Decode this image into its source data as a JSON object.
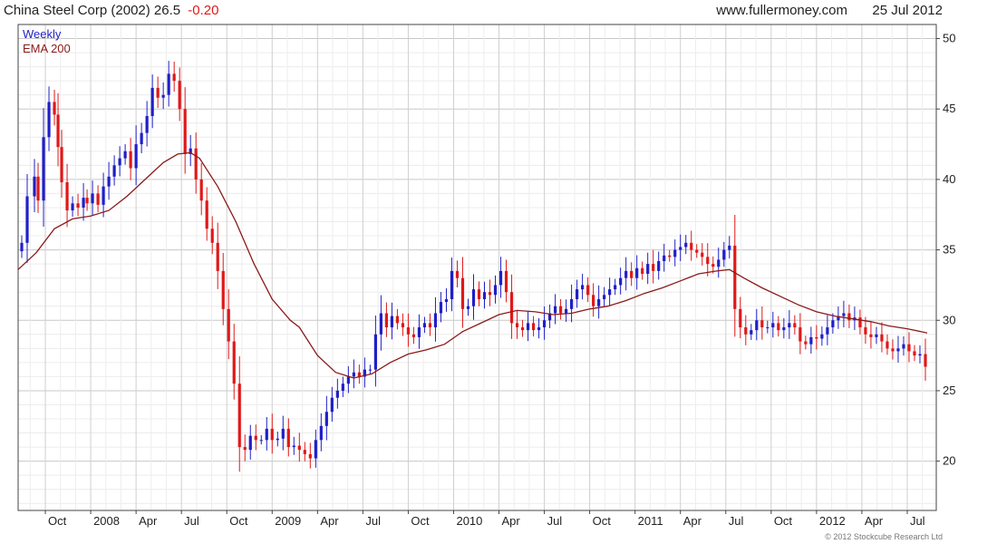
{
  "header": {
    "name_and_price": "China Steel Corp (2002) 26.5",
    "change": "-0.20",
    "site": "www.fullermoney.com",
    "date": "25 Jul 2012",
    "copyright": "© 2012 Stockcube Research Ltd"
  },
  "colors": {
    "up": "#1f1fc8",
    "down": "#e01818",
    "ema": "#8b1a1a",
    "grid": "#d8d8d8",
    "change": "#e01818"
  },
  "chart_data": {
    "type": "candlestick",
    "legend": [
      "Weekly",
      "EMA 200"
    ],
    "legend_placement": "top-left",
    "yaxis_side": "right",
    "ylim": [
      16.5,
      51
    ],
    "y_ticks": [
      20,
      25,
      30,
      35,
      40,
      45,
      50
    ],
    "x_range": [
      2007.6,
      2012.66
    ],
    "x_ticks": [
      {
        "label": "Oct",
        "x": 2007.75
      },
      {
        "label": "2008",
        "x": 2008.0
      },
      {
        "label": "Apr",
        "x": 2008.25
      },
      {
        "label": "Jul",
        "x": 2008.5
      },
      {
        "label": "Oct",
        "x": 2008.75
      },
      {
        "label": "2009",
        "x": 2009.0
      },
      {
        "label": "Apr",
        "x": 2009.25
      },
      {
        "label": "Jul",
        "x": 2009.5
      },
      {
        "label": "Oct",
        "x": 2009.75
      },
      {
        "label": "2010",
        "x": 2010.0
      },
      {
        "label": "Apr",
        "x": 2010.25
      },
      {
        "label": "Jul",
        "x": 2010.5
      },
      {
        "label": "Oct",
        "x": 2010.75
      },
      {
        "label": "2011",
        "x": 2011.0
      },
      {
        "label": "Apr",
        "x": 2011.25
      },
      {
        "label": "Jul",
        "x": 2011.5
      },
      {
        "label": "Oct",
        "x": 2011.75
      },
      {
        "label": "2012",
        "x": 2012.0
      },
      {
        "label": "Apr",
        "x": 2012.25
      },
      {
        "label": "Jul",
        "x": 2012.5
      }
    ],
    "weekly_close": [
      [
        2007.62,
        35.5
      ],
      [
        2007.65,
        38.8
      ],
      [
        2007.69,
        40.2
      ],
      [
        2007.71,
        38.5
      ],
      [
        2007.74,
        43.0
      ],
      [
        2007.77,
        45.5
      ],
      [
        2007.8,
        44.6
      ],
      [
        2007.82,
        42.3
      ],
      [
        2007.84,
        39.8
      ],
      [
        2007.87,
        37.8
      ],
      [
        2007.9,
        38.3
      ],
      [
        2007.93,
        38.0
      ],
      [
        2007.96,
        38.7
      ],
      [
        2007.98,
        38.3
      ],
      [
        2008.01,
        39.0
      ],
      [
        2008.04,
        38.2
      ],
      [
        2008.07,
        39.5
      ],
      [
        2008.1,
        40.2
      ],
      [
        2008.13,
        41.0
      ],
      [
        2008.16,
        41.5
      ],
      [
        2008.19,
        42.0
      ],
      [
        2008.22,
        40.8
      ],
      [
        2008.25,
        42.5
      ],
      [
        2008.28,
        43.3
      ],
      [
        2008.31,
        44.5
      ],
      [
        2008.34,
        46.5
      ],
      [
        2008.37,
        45.8
      ],
      [
        2008.4,
        46.0
      ],
      [
        2008.43,
        47.5
      ],
      [
        2008.46,
        47.0
      ],
      [
        2008.49,
        45.0
      ],
      [
        2008.52,
        41.8
      ],
      [
        2008.55,
        42.2
      ],
      [
        2008.58,
        40.0
      ],
      [
        2008.61,
        38.5
      ],
      [
        2008.64,
        36.5
      ],
      [
        2008.67,
        35.5
      ],
      [
        2008.7,
        33.5
      ],
      [
        2008.73,
        30.8
      ],
      [
        2008.76,
        28.5
      ],
      [
        2008.79,
        25.5
      ],
      [
        2008.82,
        21.0
      ],
      [
        2008.85,
        20.8
      ],
      [
        2008.88,
        21.8
      ],
      [
        2008.91,
        21.5
      ],
      [
        2008.94,
        21.5
      ],
      [
        2008.97,
        22.3
      ],
      [
        2009.0,
        21.5
      ],
      [
        2009.03,
        21.6
      ],
      [
        2009.06,
        22.3
      ],
      [
        2009.09,
        21.0
      ],
      [
        2009.12,
        21.1
      ],
      [
        2009.15,
        20.8
      ],
      [
        2009.18,
        20.5
      ],
      [
        2009.21,
        20.2
      ],
      [
        2009.24,
        21.5
      ],
      [
        2009.27,
        22.5
      ],
      [
        2009.3,
        23.5
      ],
      [
        2009.33,
        24.5
      ],
      [
        2009.36,
        25.0
      ],
      [
        2009.39,
        25.5
      ],
      [
        2009.42,
        26.0
      ],
      [
        2009.45,
        26.3
      ],
      [
        2009.48,
        26.0
      ],
      [
        2009.51,
        26.5
      ],
      [
        2009.54,
        26.5
      ],
      [
        2009.57,
        29.0
      ],
      [
        2009.6,
        30.5
      ],
      [
        2009.63,
        29.5
      ],
      [
        2009.66,
        30.3
      ],
      [
        2009.69,
        29.8
      ],
      [
        2009.72,
        29.5
      ],
      [
        2009.75,
        29.0
      ],
      [
        2009.78,
        28.8
      ],
      [
        2009.81,
        29.5
      ],
      [
        2009.84,
        29.8
      ],
      [
        2009.87,
        29.5
      ],
      [
        2009.9,
        30.5
      ],
      [
        2009.93,
        31.3
      ],
      [
        2009.96,
        31.5
      ],
      [
        2009.99,
        33.5
      ],
      [
        2010.02,
        33.0
      ],
      [
        2010.05,
        30.8
      ],
      [
        2010.08,
        31.0
      ],
      [
        2010.11,
        32.2
      ],
      [
        2010.14,
        31.5
      ],
      [
        2010.17,
        32.0
      ],
      [
        2010.2,
        31.8
      ],
      [
        2010.23,
        32.5
      ],
      [
        2010.26,
        33.5
      ],
      [
        2010.29,
        32.0
      ],
      [
        2010.32,
        29.8
      ],
      [
        2010.35,
        29.5
      ],
      [
        2010.38,
        29.3
      ],
      [
        2010.41,
        29.8
      ],
      [
        2010.44,
        29.3
      ],
      [
        2010.47,
        29.5
      ],
      [
        2010.5,
        30.0
      ],
      [
        2010.53,
        30.5
      ],
      [
        2010.56,
        31.0
      ],
      [
        2010.59,
        30.5
      ],
      [
        2010.62,
        30.8
      ],
      [
        2010.65,
        31.5
      ],
      [
        2010.68,
        32.2
      ],
      [
        2010.71,
        32.5
      ],
      [
        2010.74,
        31.8
      ],
      [
        2010.77,
        31.0
      ],
      [
        2010.8,
        31.5
      ],
      [
        2010.83,
        31.8
      ],
      [
        2010.86,
        32.2
      ],
      [
        2010.89,
        32.5
      ],
      [
        2010.92,
        33.0
      ],
      [
        2010.95,
        33.5
      ],
      [
        2010.98,
        33.0
      ],
      [
        2011.01,
        33.7
      ],
      [
        2011.04,
        33.3
      ],
      [
        2011.07,
        34.0
      ],
      [
        2011.1,
        33.5
      ],
      [
        2011.13,
        34.2
      ],
      [
        2011.16,
        34.6
      ],
      [
        2011.19,
        34.5
      ],
      [
        2011.22,
        35.0
      ],
      [
        2011.25,
        35.2
      ],
      [
        2011.28,
        35.5
      ],
      [
        2011.31,
        35.0
      ],
      [
        2011.34,
        34.8
      ],
      [
        2011.37,
        34.5
      ],
      [
        2011.4,
        34.0
      ],
      [
        2011.43,
        33.8
      ],
      [
        2011.46,
        34.3
      ],
      [
        2011.49,
        35.0
      ],
      [
        2011.52,
        35.3
      ],
      [
        2011.55,
        30.8
      ],
      [
        2011.58,
        29.5
      ],
      [
        2011.61,
        29.0
      ],
      [
        2011.64,
        29.3
      ],
      [
        2011.67,
        30.0
      ],
      [
        2011.7,
        29.5
      ],
      [
        2011.73,
        29.5
      ],
      [
        2011.76,
        29.8
      ],
      [
        2011.79,
        29.3
      ],
      [
        2011.82,
        29.5
      ],
      [
        2011.85,
        29.8
      ],
      [
        2011.88,
        29.5
      ],
      [
        2011.91,
        28.5
      ],
      [
        2011.94,
        28.3
      ],
      [
        2011.97,
        28.8
      ],
      [
        2012.0,
        28.7
      ],
      [
        2012.03,
        29.0
      ],
      [
        2012.06,
        29.5
      ],
      [
        2012.09,
        30.0
      ],
      [
        2012.12,
        30.3
      ],
      [
        2012.15,
        30.5
      ],
      [
        2012.18,
        30.0
      ],
      [
        2012.21,
        30.2
      ],
      [
        2012.24,
        29.5
      ],
      [
        2012.27,
        29.0
      ],
      [
        2012.3,
        28.8
      ],
      [
        2012.33,
        29.0
      ],
      [
        2012.36,
        28.5
      ],
      [
        2012.39,
        28.0
      ],
      [
        2012.42,
        27.8
      ],
      [
        2012.45,
        28.0
      ],
      [
        2012.48,
        28.3
      ],
      [
        2012.51,
        27.8
      ],
      [
        2012.54,
        27.5
      ],
      [
        2012.57,
        27.6
      ],
      [
        2012.6,
        26.7
      ]
    ],
    "ema_200": [
      [
        2007.6,
        33.6
      ],
      [
        2007.7,
        34.8
      ],
      [
        2007.8,
        36.5
      ],
      [
        2007.9,
        37.2
      ],
      [
        2008.0,
        37.4
      ],
      [
        2008.1,
        37.8
      ],
      [
        2008.2,
        38.8
      ],
      [
        2008.3,
        40.0
      ],
      [
        2008.4,
        41.2
      ],
      [
        2008.48,
        41.8
      ],
      [
        2008.55,
        41.9
      ],
      [
        2008.6,
        41.5
      ],
      [
        2008.7,
        39.5
      ],
      [
        2008.8,
        37.0
      ],
      [
        2008.9,
        34.0
      ],
      [
        2009.0,
        31.5
      ],
      [
        2009.1,
        30.0
      ],
      [
        2009.15,
        29.5
      ],
      [
        2009.25,
        27.5
      ],
      [
        2009.35,
        26.3
      ],
      [
        2009.45,
        25.9
      ],
      [
        2009.55,
        26.2
      ],
      [
        2009.65,
        27.0
      ],
      [
        2009.75,
        27.6
      ],
      [
        2009.85,
        27.9
      ],
      [
        2009.95,
        28.3
      ],
      [
        2010.05,
        29.2
      ],
      [
        2010.15,
        29.8
      ],
      [
        2010.25,
        30.4
      ],
      [
        2010.35,
        30.7
      ],
      [
        2010.45,
        30.6
      ],
      [
        2010.55,
        30.4
      ],
      [
        2010.65,
        30.5
      ],
      [
        2010.75,
        30.8
      ],
      [
        2010.85,
        31.0
      ],
      [
        2010.95,
        31.4
      ],
      [
        2011.05,
        31.9
      ],
      [
        2011.15,
        32.3
      ],
      [
        2011.25,
        32.8
      ],
      [
        2011.35,
        33.3
      ],
      [
        2011.45,
        33.5
      ],
      [
        2011.52,
        33.6
      ],
      [
        2011.6,
        33.0
      ],
      [
        2011.7,
        32.3
      ],
      [
        2011.8,
        31.7
      ],
      [
        2011.9,
        31.1
      ],
      [
        2012.0,
        30.6
      ],
      [
        2012.1,
        30.3
      ],
      [
        2012.2,
        30.1
      ],
      [
        2012.3,
        29.9
      ],
      [
        2012.4,
        29.6
      ],
      [
        2012.5,
        29.4
      ],
      [
        2012.61,
        29.1
      ]
    ]
  }
}
